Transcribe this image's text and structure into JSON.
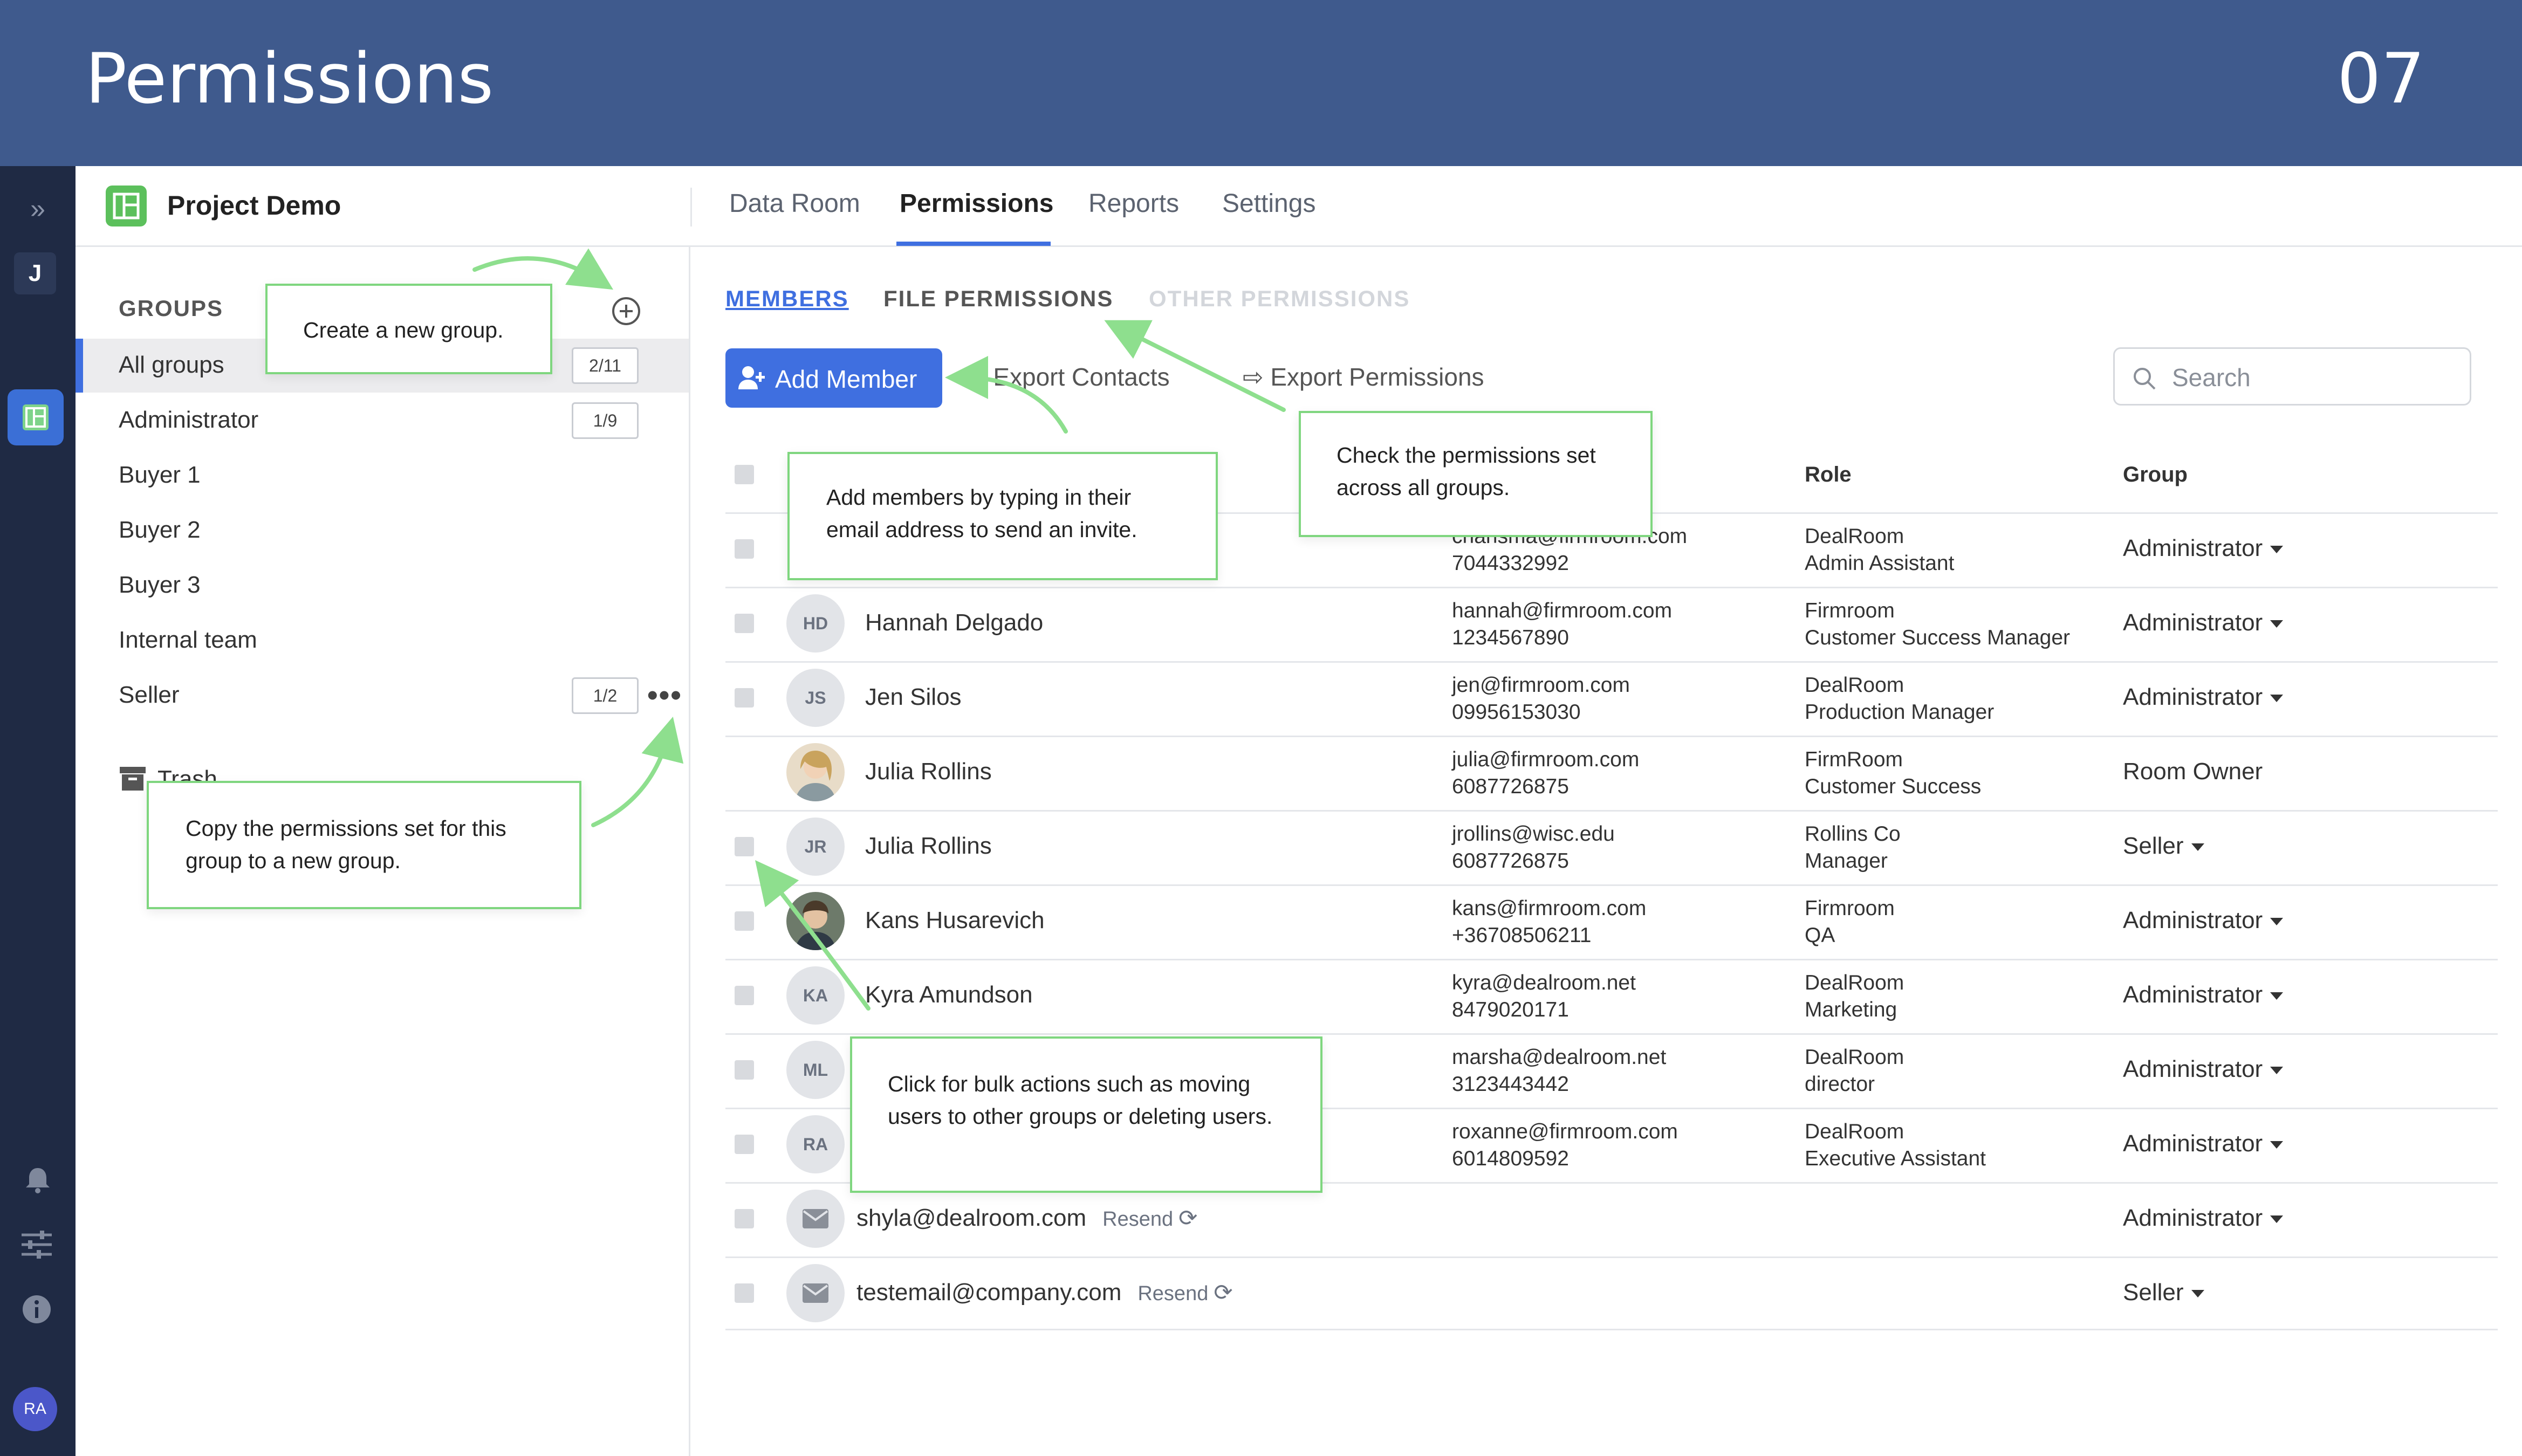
{
  "banner": {
    "title": "Permissions",
    "number": "07"
  },
  "rail": {
    "expand_icon": "double-chevron-right-icon",
    "user_initial": "J",
    "app_icon": "layout-icon",
    "bottom_icons": [
      "bell-icon",
      "sliders-icon",
      "info-icon"
    ],
    "user_avatar": "RA"
  },
  "project": {
    "name": "Project Demo",
    "icon": "layout-icon"
  },
  "nav": {
    "tabs": [
      "Data Room",
      "Permissions",
      "Reports",
      "Settings"
    ],
    "active": "Permissions"
  },
  "sidebar": {
    "heading": "GROUPS",
    "groups": [
      {
        "name": "All groups",
        "badge": "2/11"
      },
      {
        "name": "Administrator",
        "badge": "1/9"
      },
      {
        "name": "Buyer 1",
        "badge": ""
      },
      {
        "name": "Buyer 2",
        "badge": ""
      },
      {
        "name": "Buyer 3",
        "badge": ""
      },
      {
        "name": "Internal team",
        "badge": ""
      },
      {
        "name": "Seller",
        "badge": "1/2"
      }
    ],
    "trash": "Trash"
  },
  "subtabs": {
    "members": "MEMBERS",
    "file_permissions": "FILE PERMISSIONS",
    "other_permissions": "OTHER PERMISSIONS"
  },
  "toolbar": {
    "add_member": "Add Member",
    "export_contacts": "Export Contacts",
    "export_permissions": "Export Permissions",
    "search_placeholder": "Search"
  },
  "table": {
    "headers": {
      "role": "Role",
      "group": "Group"
    },
    "rows": [
      {
        "initials": "",
        "name": "",
        "email": "charisma@firmroom.com",
        "phone": "7044332992",
        "company": "DealRoom",
        "title": "Admin Assistant",
        "group": "Administrator",
        "dropdown": true
      },
      {
        "initials": "HD",
        "name": "Hannah Delgado",
        "email": "hannah@firmroom.com",
        "phone": "1234567890",
        "company": "Firmroom",
        "title": "Customer Success Manager",
        "group": "Administrator",
        "dropdown": true
      },
      {
        "initials": "JS",
        "name": "Jen Silos",
        "email": "jen@firmroom.com",
        "phone": "09956153030",
        "company": "DealRoom",
        "title": "Production Manager",
        "group": "Administrator",
        "dropdown": true
      },
      {
        "initials": "photo",
        "name": "Julia Rollins",
        "email": "julia@firmroom.com",
        "phone": "6087726875",
        "company": "FirmRoom",
        "title": "Customer Success",
        "group": "Room Owner",
        "dropdown": false
      },
      {
        "initials": "JR",
        "name": "Julia Rollins",
        "email": "jrollins@wisc.edu",
        "phone": "6087726875",
        "company": "Rollins Co",
        "title": "Manager",
        "group": "Seller",
        "dropdown": true
      },
      {
        "initials": "photo",
        "name": "Kans Husarevich",
        "email": "kans@firmroom.com",
        "phone": "+36708506211",
        "company": "Firmroom",
        "title": "QA",
        "group": "Administrator",
        "dropdown": true
      },
      {
        "initials": "KA",
        "name": "Kyra Amundson",
        "email": "kyra@dealroom.net",
        "phone": "8479020171",
        "company": "DealRoom",
        "title": "Marketing",
        "group": "Administrator",
        "dropdown": true
      },
      {
        "initials": "ML",
        "name": "",
        "email": "marsha@dealroom.net",
        "phone": "3123443442",
        "company": "DealRoom",
        "title": "director",
        "group": "Administrator",
        "dropdown": true
      },
      {
        "initials": "RA",
        "name": "",
        "email": "roxanne@firmroom.com",
        "phone": "6014809592",
        "company": "DealRoom",
        "title": "Executive Assistant",
        "group": "Administrator",
        "dropdown": true
      }
    ],
    "invites": [
      {
        "email": "shyla@dealroom.com",
        "resend": "Resend",
        "group": "Administrator"
      },
      {
        "email": "testemail@company.com",
        "resend": "Resend",
        "group": "Seller"
      }
    ]
  },
  "callouts": {
    "create_group": "Create a new group.",
    "add_members": "Add members by typing in their email address to send an invite.",
    "check_permissions": "Check the permissions set across all groups.",
    "copy_permissions": "Copy the permissions set for this group to a new group.",
    "bulk_actions": "Click for bulk actions such as moving users to other groups or deleting users."
  },
  "colors": {
    "banner": "#3f5a8d",
    "rail": "#1f2a44",
    "accent": "#3f6fe0",
    "callout_border": "#7fd67f",
    "project_icon": "#5cc05c"
  }
}
